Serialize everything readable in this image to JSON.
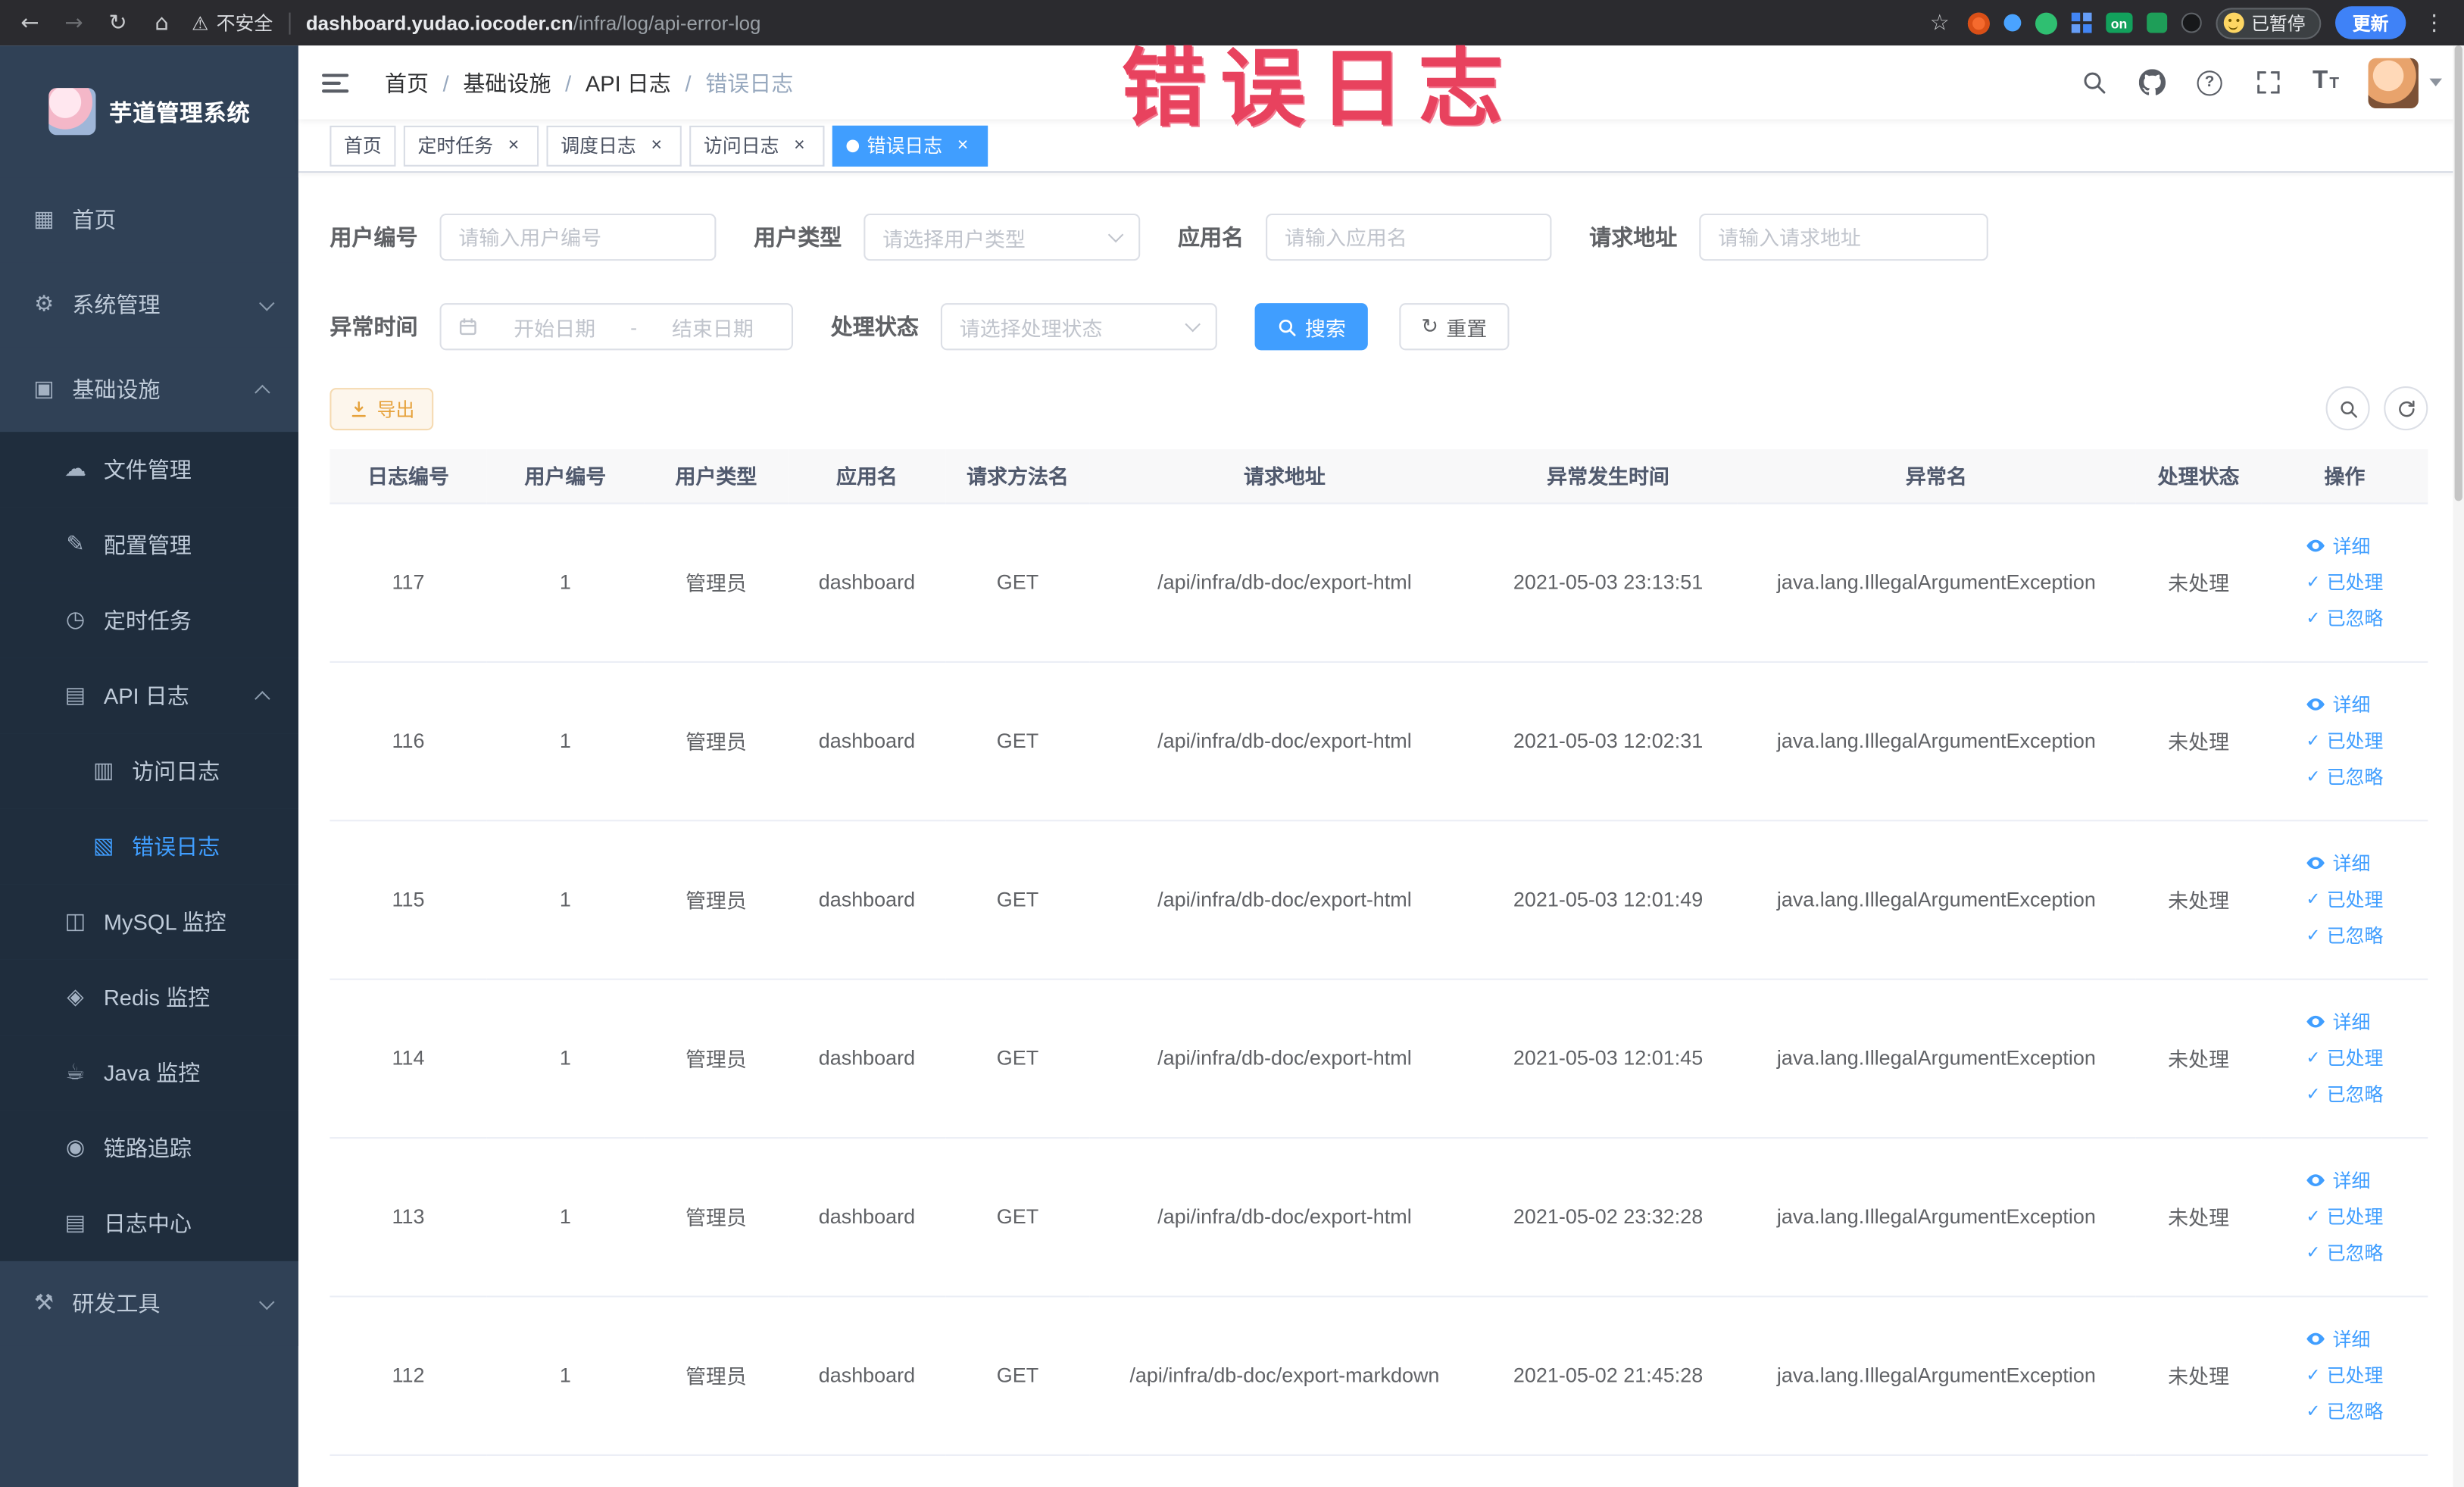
{
  "browser": {
    "security_label": "不安全",
    "url_domain": "dashboard.yudao.iocoder.cn",
    "url_path": "/infra/log/api-error-log",
    "on_badge": "on",
    "paused_badge": "已暂停",
    "update_button": "更新"
  },
  "watermark": "错误日志",
  "sidebar": {
    "logo_title": "芋道管理系统",
    "items": [
      {
        "label": "首页",
        "icon": "dashboard"
      },
      {
        "label": "系统管理",
        "icon": "gear",
        "expand": "down"
      },
      {
        "label": "基础设施",
        "icon": "infrastructure",
        "expand": "up"
      },
      {
        "label": "文件管理",
        "icon": "file"
      },
      {
        "label": "配置管理",
        "icon": "config"
      },
      {
        "label": "定时任务",
        "icon": "job"
      },
      {
        "label": "API 日志",
        "icon": "api_log",
        "expand": "up"
      },
      {
        "label": "访问日志",
        "icon": "access_log"
      },
      {
        "label": "错误日志",
        "icon": "error_log",
        "active": true
      },
      {
        "label": "MySQL 监控",
        "icon": "mysql"
      },
      {
        "label": "Redis 监控",
        "icon": "redis"
      },
      {
        "label": "Java 监控",
        "icon": "java"
      },
      {
        "label": "链路追踪",
        "icon": "trace"
      },
      {
        "label": "日志中心",
        "icon": "log_center"
      },
      {
        "label": "研发工具",
        "icon": "devtools",
        "expand": "down"
      }
    ]
  },
  "header": {
    "breadcrumb": [
      "首页",
      "基础设施",
      "API 日志",
      "错误日志"
    ],
    "separator": "/"
  },
  "tabs": [
    {
      "label": "首页",
      "closable": false,
      "active": false
    },
    {
      "label": "定时任务",
      "closable": true,
      "active": false
    },
    {
      "label": "调度日志",
      "closable": true,
      "active": false
    },
    {
      "label": "访问日志",
      "closable": true,
      "active": false
    },
    {
      "label": "错误日志",
      "closable": true,
      "active": true
    }
  ],
  "filters": {
    "user_id": {
      "label": "用户编号",
      "placeholder": "请输入用户编号"
    },
    "user_type": {
      "label": "用户类型",
      "placeholder": "请选择用户类型"
    },
    "app_name": {
      "label": "应用名",
      "placeholder": "请输入应用名"
    },
    "request_url": {
      "label": "请求地址",
      "placeholder": "请输入请求地址"
    },
    "exception_time": {
      "label": "异常时间",
      "start_placeholder": "开始日期",
      "separator": "-",
      "end_placeholder": "结束日期"
    },
    "process_status": {
      "label": "处理状态",
      "placeholder": "请选择处理状态"
    },
    "search_button": "搜索",
    "reset_button": "重置"
  },
  "toolbar": {
    "export_button": "导出"
  },
  "table": {
    "columns": [
      "日志编号",
      "用户编号",
      "用户类型",
      "应用名",
      "请求方法名",
      "请求地址",
      "异常发生时间",
      "异常名",
      "处理状态",
      "操作"
    ],
    "actions": {
      "detail": "详细",
      "processed": "已处理",
      "ignored": "已忽略"
    },
    "rows": [
      {
        "id": "117",
        "user_id": "1",
        "user_type": "管理员",
        "app": "dashboard",
        "method": "GET",
        "url": "/api/infra/db-doc/export-html",
        "time": "2021-05-03 23:13:51",
        "exception": "java.lang.IllegalArgumentException",
        "status": "未处理"
      },
      {
        "id": "116",
        "user_id": "1",
        "user_type": "管理员",
        "app": "dashboard",
        "method": "GET",
        "url": "/api/infra/db-doc/export-html",
        "time": "2021-05-03 12:02:31",
        "exception": "java.lang.IllegalArgumentException",
        "status": "未处理"
      },
      {
        "id": "115",
        "user_id": "1",
        "user_type": "管理员",
        "app": "dashboard",
        "method": "GET",
        "url": "/api/infra/db-doc/export-html",
        "time": "2021-05-03 12:01:49",
        "exception": "java.lang.IllegalArgumentException",
        "status": "未处理"
      },
      {
        "id": "114",
        "user_id": "1",
        "user_type": "管理员",
        "app": "dashboard",
        "method": "GET",
        "url": "/api/infra/db-doc/export-html",
        "time": "2021-05-03 12:01:45",
        "exception": "java.lang.IllegalArgumentException",
        "status": "未处理"
      },
      {
        "id": "113",
        "user_id": "1",
        "user_type": "管理员",
        "app": "dashboard",
        "method": "GET",
        "url": "/api/infra/db-doc/export-html",
        "time": "2021-05-02 23:32:28",
        "exception": "java.lang.IllegalArgumentException",
        "status": "未处理"
      },
      {
        "id": "112",
        "user_id": "1",
        "user_type": "管理员",
        "app": "dashboard",
        "method": "GET",
        "url": "/api/infra/db-doc/export-markdown",
        "time": "2021-05-02 21:45:28",
        "exception": "java.lang.IllegalArgumentException",
        "status": "未处理"
      }
    ]
  },
  "icons": {
    "back": "←",
    "forward": "→",
    "reload": "↻",
    "home": "⌂",
    "star": "☆",
    "kebab": "⋮",
    "warning": "⚠",
    "question": "?",
    "font_size_large": "T",
    "font_size_small": "T",
    "check": "✓",
    "close": "×",
    "dashboard": "▦",
    "gear": "⚙",
    "infrastructure": "▣",
    "file": "☁",
    "config": "✎",
    "job": "◷",
    "api_log": "▤",
    "access_log": "▥",
    "error_log": "▧",
    "mysql": "◫",
    "redis": "◈",
    "java": "☕",
    "trace": "◉",
    "log_center": "▤",
    "devtools": "⚒"
  },
  "colors": {
    "accent": "#409eff",
    "warning": "#e6a23c",
    "sidebar_bg": "#304156",
    "sidebar_sub_bg": "#1f2d3d",
    "watermark": "#e8425e",
    "tag_active": "#409eff"
  }
}
